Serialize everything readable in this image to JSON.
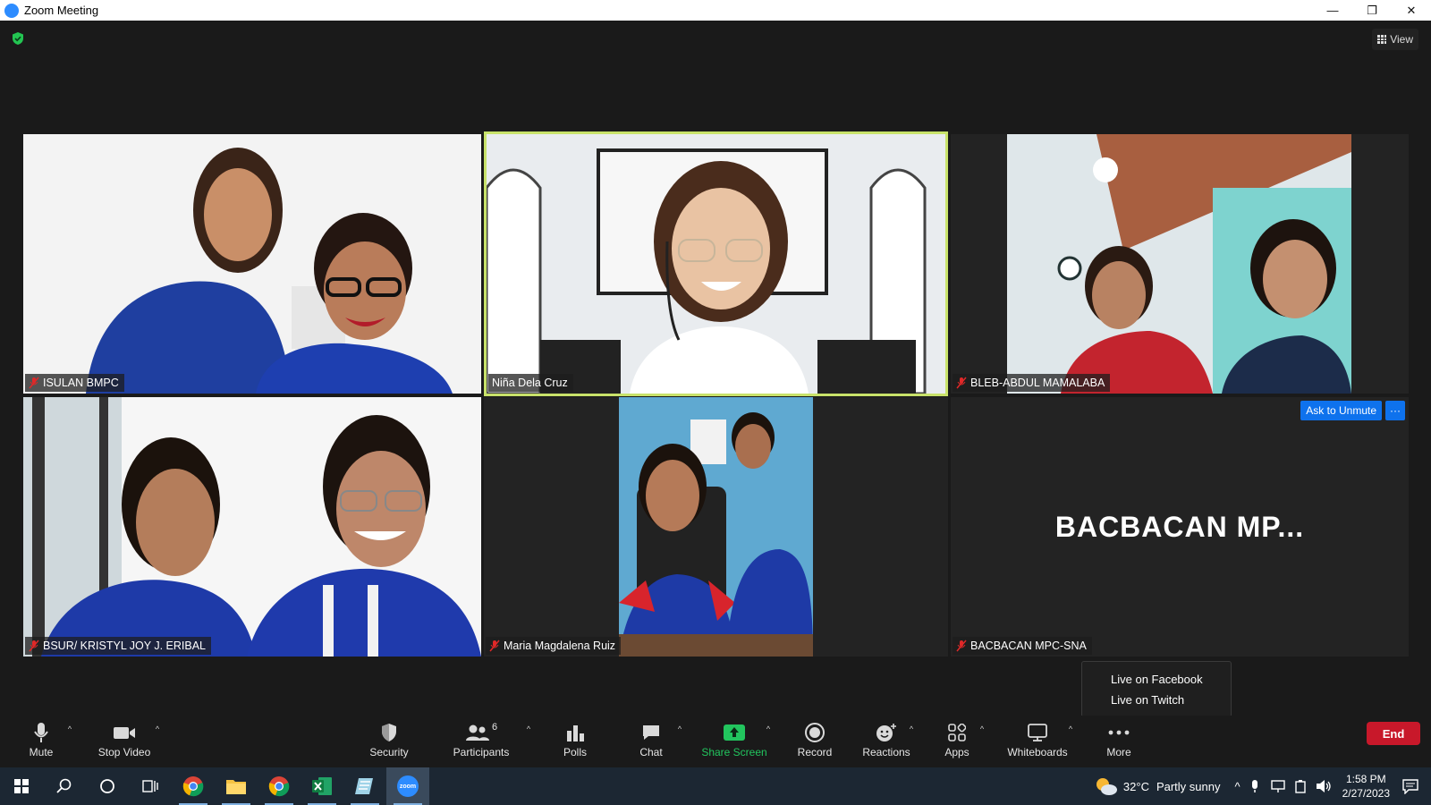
{
  "window": {
    "title": "Zoom Meeting",
    "minimize": "—",
    "maximize": "❐",
    "close": "✕"
  },
  "topbar": {
    "view_label": "View"
  },
  "tiles": [
    {
      "name": "ISULAN BMPC",
      "muted": true
    },
    {
      "name": "Niña Dela Cruz",
      "muted": false,
      "active": true
    },
    {
      "name": "BLEB-ABDUL MAMALABA",
      "muted": true
    },
    {
      "name": "BSUR/ KRISTYL JOY J. ERIBAL",
      "muted": true
    },
    {
      "name": "Maria Magdalena Ruiz",
      "muted": true
    },
    {
      "name": "BACBACAN MPC-SNA",
      "muted": true,
      "display_name": "BACBACAN  MP...",
      "ask_to_unmute": "Ask to Unmute",
      "more": "···"
    }
  ],
  "popup": {
    "items": [
      "Live on Facebook",
      "Live on Twitch"
    ]
  },
  "toolbar": {
    "mute": "Mute",
    "stop_video": "Stop Video",
    "security": "Security",
    "participants": "Participants",
    "participants_count": "6",
    "polls": "Polls",
    "chat": "Chat",
    "share_screen": "Share Screen",
    "record": "Record",
    "reactions": "Reactions",
    "apps": "Apps",
    "whiteboards": "Whiteboards",
    "more": "More",
    "end": "End"
  },
  "taskbar": {
    "weather_temp": "32°C",
    "weather_text": "Partly sunny",
    "time": "1:58 PM",
    "date": "2/27/2023",
    "zoom_label": "zoom"
  },
  "colors": {
    "accent": "#0e72ed",
    "end": "#c8182a",
    "share": "#22c55e",
    "active_border": "#c8e26a"
  }
}
